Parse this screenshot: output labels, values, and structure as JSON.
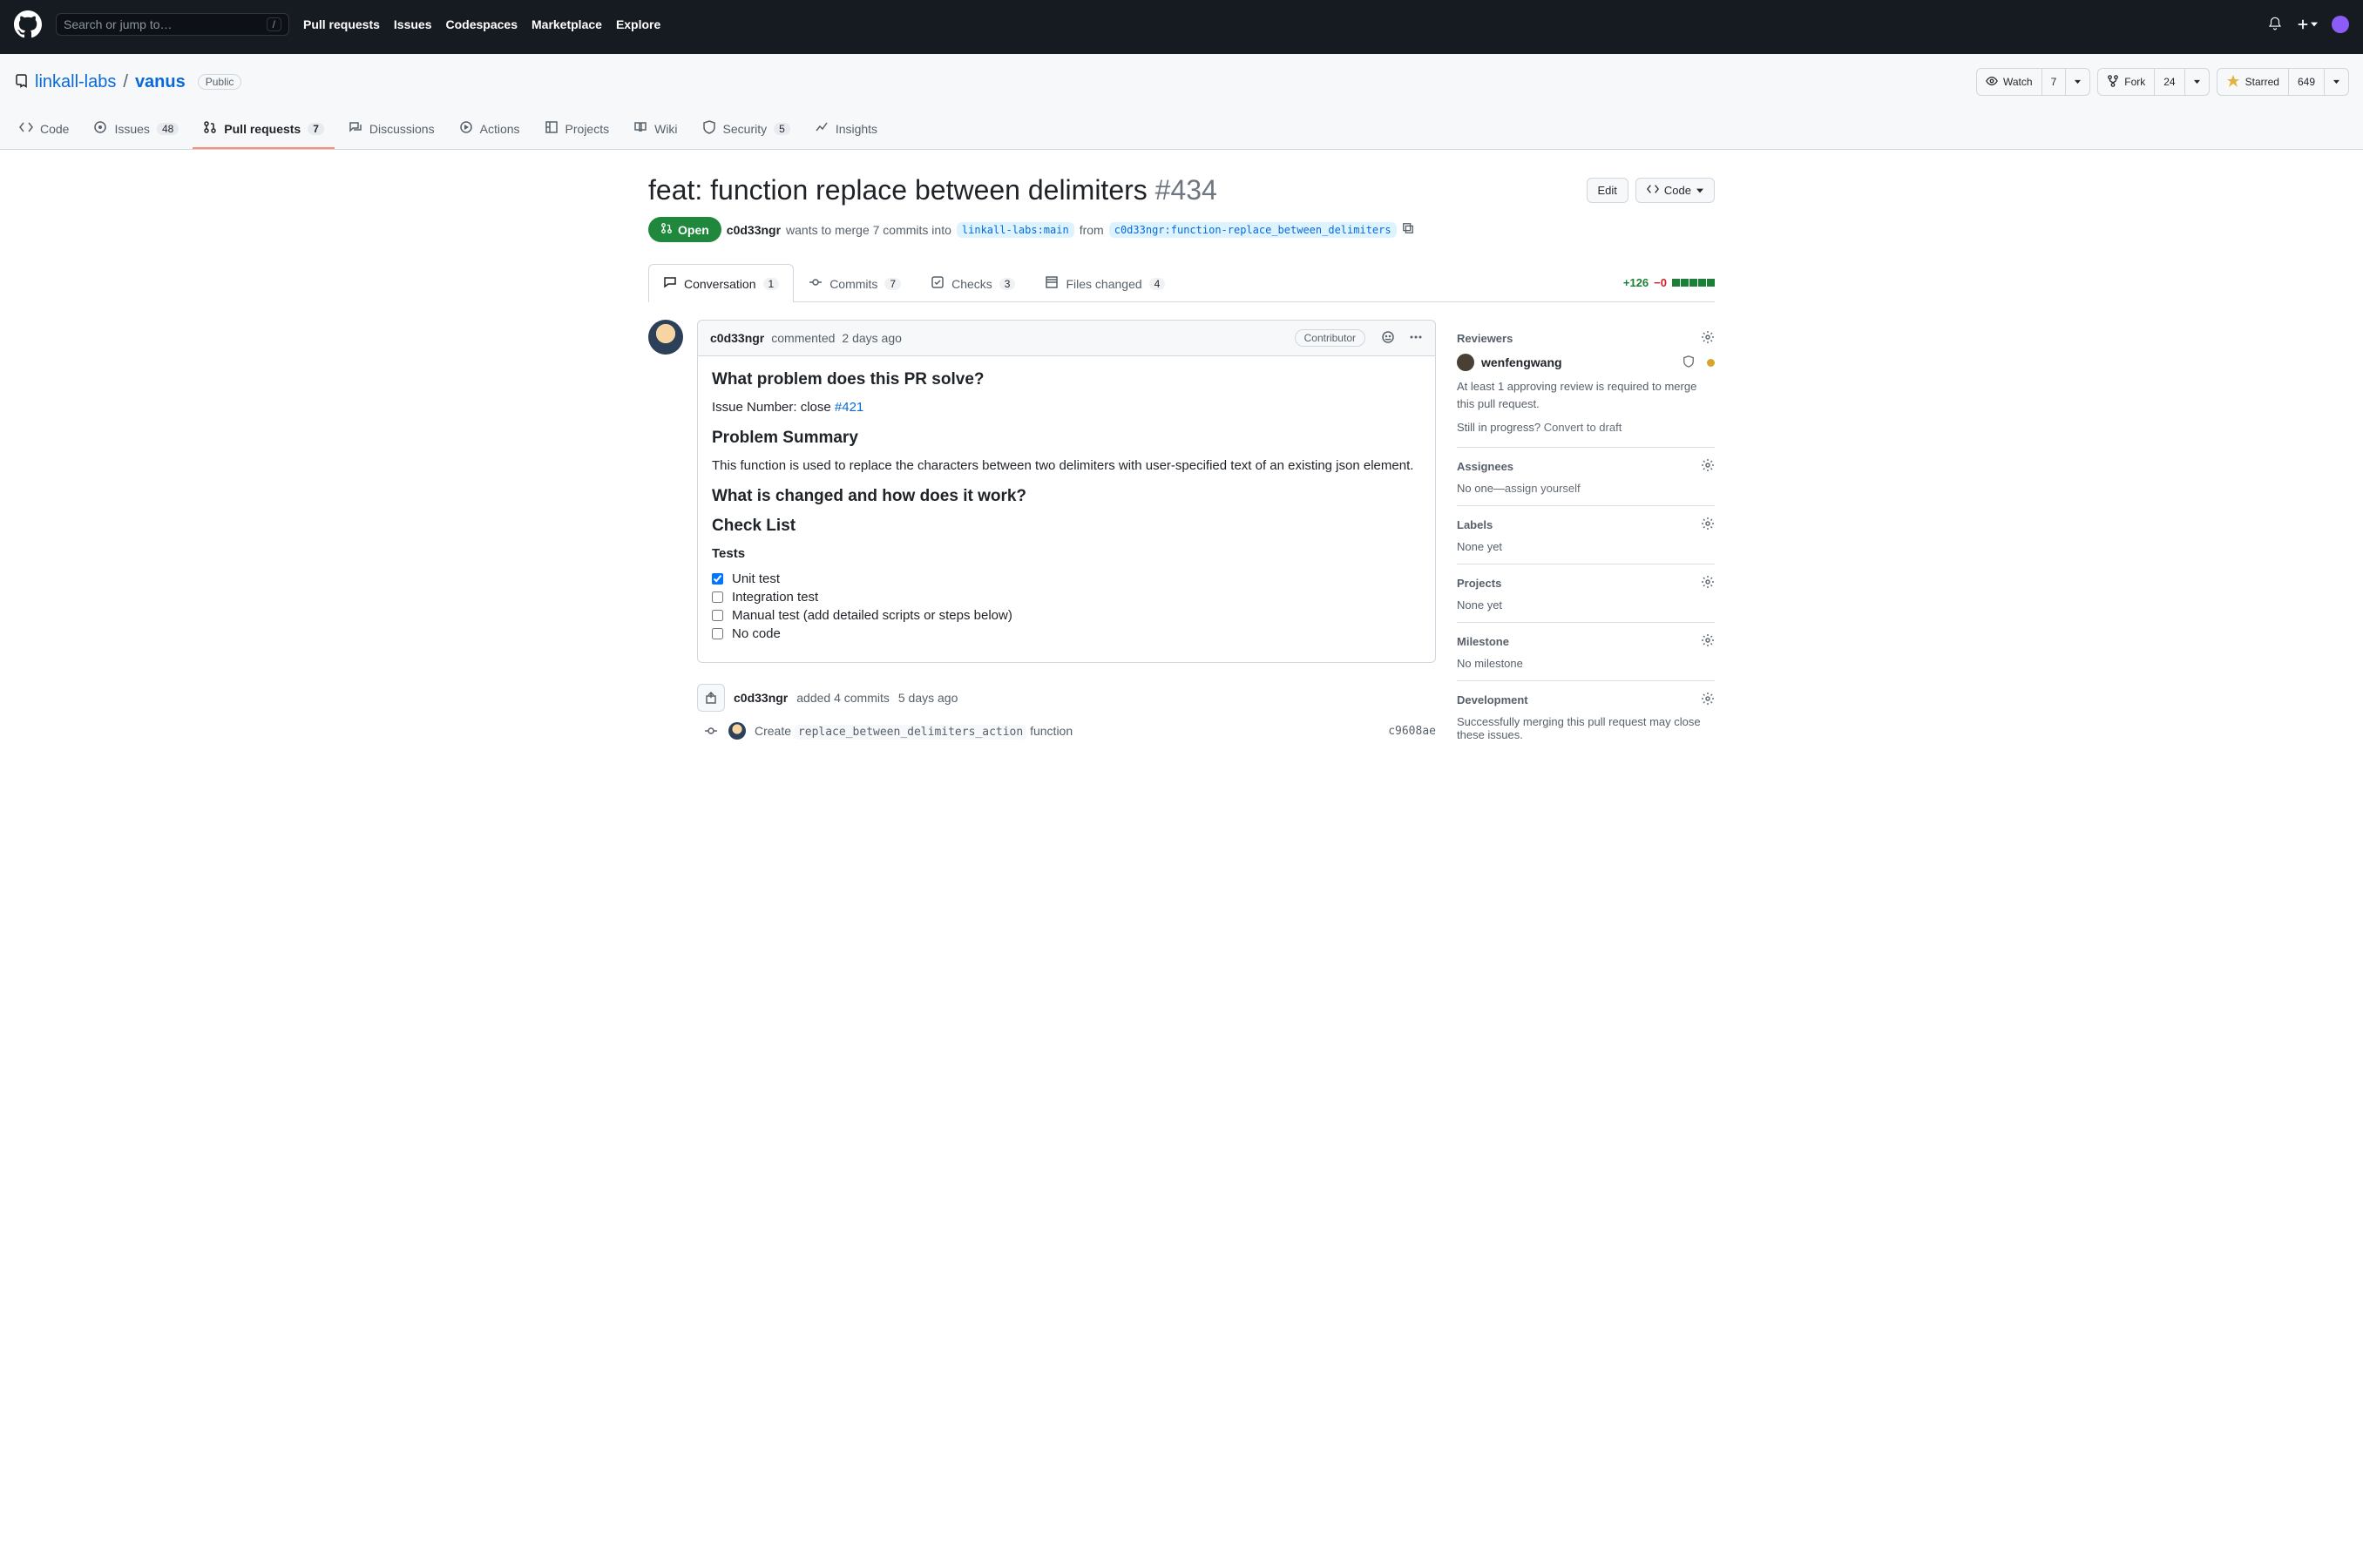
{
  "header": {
    "search_placeholder": "Search or jump to…",
    "nav": {
      "pull_requests": "Pull requests",
      "issues": "Issues",
      "codespaces": "Codespaces",
      "marketplace": "Marketplace",
      "explore": "Explore"
    }
  },
  "repo": {
    "owner": "linkall-labs",
    "name": "vanus",
    "visibility": "Public",
    "watch_label": "Watch",
    "watch_count": "7",
    "fork_label": "Fork",
    "fork_count": "24",
    "starred_label": "Starred",
    "star_count": "649"
  },
  "repo_tabs": {
    "code": "Code",
    "issues": "Issues",
    "issues_count": "48",
    "pulls": "Pull requests",
    "pulls_count": "7",
    "discussions": "Discussions",
    "actions": "Actions",
    "projects": "Projects",
    "wiki": "Wiki",
    "security": "Security",
    "security_count": "5",
    "insights": "Insights"
  },
  "pr": {
    "title": "feat: function replace between delimiters",
    "number": "#434",
    "edit_label": "Edit",
    "code_label": "Code",
    "state": "Open",
    "author": "c0d33ngr",
    "wants_text_a": "wants to merge 7 commits into",
    "base_branch": "linkall-labs:main",
    "from_text": "from",
    "head_branch": "c0d33ngr:function-replace_between_delimiters",
    "subtabs": {
      "conversation": "Conversation",
      "conversation_count": "1",
      "commits": "Commits",
      "commits_count": "7",
      "checks": "Checks",
      "checks_count": "3",
      "files": "Files changed",
      "files_count": "4"
    },
    "diff_add": "+126",
    "diff_del": "−0"
  },
  "comment": {
    "author": "c0d33ngr",
    "action": "commented",
    "when": "2 days ago",
    "role": "Contributor",
    "h1": "What problem does this PR solve?",
    "issue_prefix": "Issue Number: close ",
    "issue_link": "#421",
    "h2": "Problem Summary",
    "summary": "This function is used to replace the characters between two delimiters with user-specified text of an existing json element.",
    "h3": "What is changed and how does it work?",
    "h4": "Check List",
    "tests_label": "Tests",
    "tests": {
      "unit": "Unit test",
      "integration": "Integration test",
      "manual": "Manual test (add detailed scripts or steps below)",
      "nocode": "No code"
    }
  },
  "event": {
    "author": "c0d33ngr",
    "text": "added 4 commits",
    "when": "5 days ago"
  },
  "commit1": {
    "prefix": "Create ",
    "code": "replace_between_delimiters_action",
    "suffix": " function",
    "sha": "c9608ae"
  },
  "sidebar": {
    "reviewers_title": "Reviewers",
    "reviewer_name": "wenfengwang",
    "review_note": "At least 1 approving review is required to merge this pull request.",
    "draft_prefix": "Still in progress? ",
    "draft_link": "Convert to draft",
    "assignees_title": "Assignees",
    "assignees_text_a": "No one—",
    "assignees_text_b": "assign yourself",
    "labels_title": "Labels",
    "labels_text": "None yet",
    "projects_title": "Projects",
    "projects_text": "None yet",
    "milestone_title": "Milestone",
    "milestone_text": "No milestone",
    "development_title": "Development",
    "development_text": "Successfully merging this pull request may close these issues."
  }
}
